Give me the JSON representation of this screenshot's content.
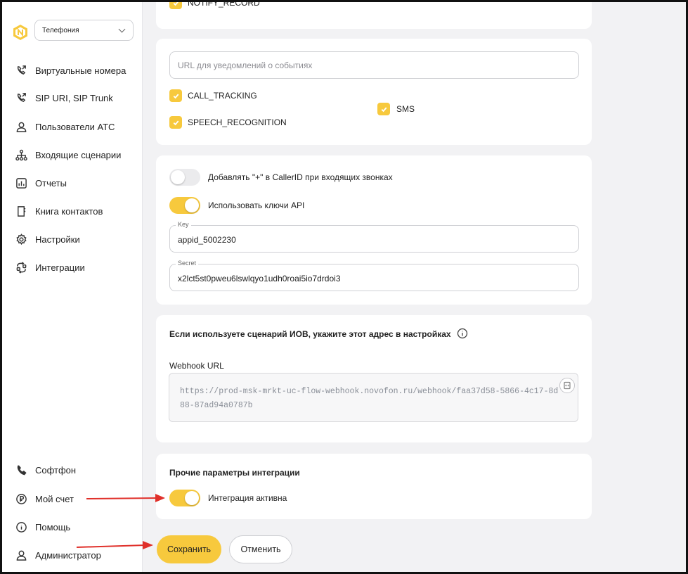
{
  "sidebar": {
    "product": "Телефония",
    "items": [
      {
        "label": "Виртуальные номера",
        "icon": "phone-forward-icon"
      },
      {
        "label": "SIP URI, SIP Trunk",
        "icon": "phone-forward-icon"
      },
      {
        "label": "Пользователи АТС",
        "icon": "user-icon"
      },
      {
        "label": "Входящие сценарии",
        "icon": "hierarchy-icon"
      },
      {
        "label": "Отчеты",
        "icon": "chart-icon"
      },
      {
        "label": "Книга контактов",
        "icon": "book-icon"
      },
      {
        "label": "Настройки",
        "icon": "gear-icon"
      },
      {
        "label": "Интеграции",
        "icon": "integration-icon"
      }
    ],
    "bottom_items": [
      {
        "label": "Софтфон",
        "icon": "phone-icon"
      },
      {
        "label": "Мой счет",
        "icon": "ruble-icon"
      },
      {
        "label": "Помощь",
        "icon": "info-icon"
      },
      {
        "label": "Администратор",
        "icon": "user-icon"
      }
    ]
  },
  "main": {
    "top_checkbox_label": "NOTIFY_RECORD",
    "events_card": {
      "url_placeholder": "URL для уведомлений о событиях",
      "checkboxes": [
        {
          "label": "CALL_TRACKING",
          "checked": true
        },
        {
          "label": "SPEECH_RECOGNITION",
          "checked": true
        },
        {
          "label": "SMS",
          "checked": true
        }
      ]
    },
    "api_card": {
      "toggle_plus_label": "Добавлять \"+\" в CallerID при входящих звонках",
      "toggle_plus_on": false,
      "toggle_api_label": "Использовать ключи API",
      "toggle_api_on": true,
      "key_label": "Key",
      "key_value": "appid_5002230",
      "secret_label": "Secret",
      "secret_value": "x2lct5st0pweu6lswlqyo1udh0roai5io7drdoi3"
    },
    "webhook_card": {
      "title": "Если используете сценарий ИОВ, укажите этот адрес в настройках",
      "url_label": "Webhook URL",
      "url_value": "https://prod-msk-mrkt-uc-flow-webhook.novofon.ru/webhook/faa37d58-5866-4c17-8d88-87ad94a0787b"
    },
    "other_card": {
      "title": "Прочие параметры интеграции",
      "toggle_label": "Интеграция активна",
      "toggle_on": true
    },
    "actions": {
      "save_label": "Сохранить",
      "cancel_label": "Отменить"
    }
  },
  "colors": {
    "accent": "#f7c93d",
    "annotation_arrow": "#e0302a",
    "background": "#f2f2f4"
  }
}
